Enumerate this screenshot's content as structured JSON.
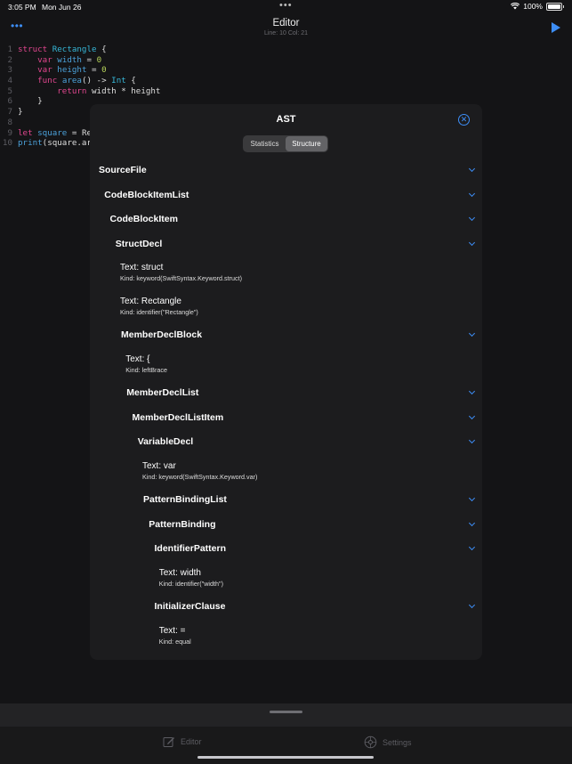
{
  "status_bar": {
    "time": "3:05 PM",
    "date": "Mon Jun 26",
    "dots": "•••",
    "battery": "100%"
  },
  "nav": {
    "title": "Editor",
    "subtitle": "Line: 10 Col: 21",
    "more_label": "•••"
  },
  "code": {
    "line_numbers": [
      "1",
      "2",
      "3",
      "4",
      "5",
      "6",
      "7",
      "8",
      "9",
      "10"
    ],
    "lines": [
      [
        {
          "t": "struct ",
          "c": "kw"
        },
        {
          "t": "Rectangle",
          "c": "ty"
        },
        {
          "t": " {",
          "c": "pl"
        }
      ],
      [
        {
          "t": "    ",
          "c": "pl"
        },
        {
          "t": "var ",
          "c": "kw"
        },
        {
          "t": "width",
          "c": "fn"
        },
        {
          "t": " = ",
          "c": "pl"
        },
        {
          "t": "0",
          "c": "nm"
        }
      ],
      [
        {
          "t": "    ",
          "c": "pl"
        },
        {
          "t": "var ",
          "c": "kw"
        },
        {
          "t": "height",
          "c": "fn"
        },
        {
          "t": " = ",
          "c": "pl"
        },
        {
          "t": "0",
          "c": "nm"
        }
      ],
      [
        {
          "t": "    ",
          "c": "pl"
        },
        {
          "t": "func ",
          "c": "kw"
        },
        {
          "t": "area",
          "c": "fn"
        },
        {
          "t": "() -> ",
          "c": "pl"
        },
        {
          "t": "Int",
          "c": "ty"
        },
        {
          "t": " {",
          "c": "pl"
        }
      ],
      [
        {
          "t": "        ",
          "c": "pl"
        },
        {
          "t": "return ",
          "c": "kw"
        },
        {
          "t": "width * height",
          "c": "pl"
        }
      ],
      [
        {
          "t": "    }",
          "c": "pl"
        }
      ],
      [
        {
          "t": "}",
          "c": "pl"
        }
      ],
      [
        {
          "t": "",
          "c": "pl"
        }
      ],
      [
        {
          "t": "let ",
          "c": "kw"
        },
        {
          "t": "square",
          "c": "fn"
        },
        {
          "t": " = Re",
          "c": "pl"
        }
      ],
      [
        {
          "t": "print",
          "c": "fn"
        },
        {
          "t": "(square.ar",
          "c": "pl"
        }
      ]
    ]
  },
  "sheet": {
    "title": "AST",
    "close_label": "✕",
    "segments": [
      "Statistics",
      "Structure"
    ],
    "selected_segment": "Structure",
    "nodes": [
      {
        "kind": "branch",
        "name": "SourceFile",
        "depth": 0
      },
      {
        "kind": "branch",
        "name": "CodeBlockItemList",
        "depth": 1
      },
      {
        "kind": "branch",
        "name": "CodeBlockItem",
        "depth": 2
      },
      {
        "kind": "branch",
        "name": "StructDecl",
        "depth": 3
      },
      {
        "kind": "leaf",
        "text": "Text: struct",
        "detail": "Kind: keyword(SwiftSyntax.Keyword.struct)",
        "depth": 4
      },
      {
        "kind": "leaf",
        "text": "Text: Rectangle",
        "detail": "Kind: identifier(\"Rectangle\")",
        "depth": 4
      },
      {
        "kind": "branch",
        "name": "MemberDeclBlock",
        "depth": 4
      },
      {
        "kind": "leaf",
        "text": "Text: {",
        "detail": "Kind: leftBrace",
        "depth": 5
      },
      {
        "kind": "branch",
        "name": "MemberDeclList",
        "depth": 5
      },
      {
        "kind": "branch",
        "name": "MemberDeclListItem",
        "depth": 6
      },
      {
        "kind": "branch",
        "name": "VariableDecl",
        "depth": 7
      },
      {
        "kind": "leaf",
        "text": "Text: var",
        "detail": "Kind: keyword(SwiftSyntax.Keyword.var)",
        "depth": 8
      },
      {
        "kind": "branch",
        "name": "PatternBindingList",
        "depth": 8
      },
      {
        "kind": "branch",
        "name": "PatternBinding",
        "depth": 9
      },
      {
        "kind": "branch",
        "name": "IdentifierPattern",
        "depth": 10
      },
      {
        "kind": "leaf",
        "text": "Text: width",
        "detail": "Kind: identifier(\"width\")",
        "depth": 11
      },
      {
        "kind": "branch",
        "name": "InitializerClause",
        "depth": 10
      },
      {
        "kind": "leaf",
        "text": "Text: =",
        "detail": "Kind: equal",
        "depth": 11
      }
    ]
  },
  "tabs": [
    {
      "label": "Editor",
      "icon": "compose-icon"
    },
    {
      "label": "Settings",
      "icon": "settings-icon"
    }
  ],
  "colors": {
    "accent": "#3d8ef7",
    "background": "#141416",
    "sheet": "#1c1c1e"
  }
}
